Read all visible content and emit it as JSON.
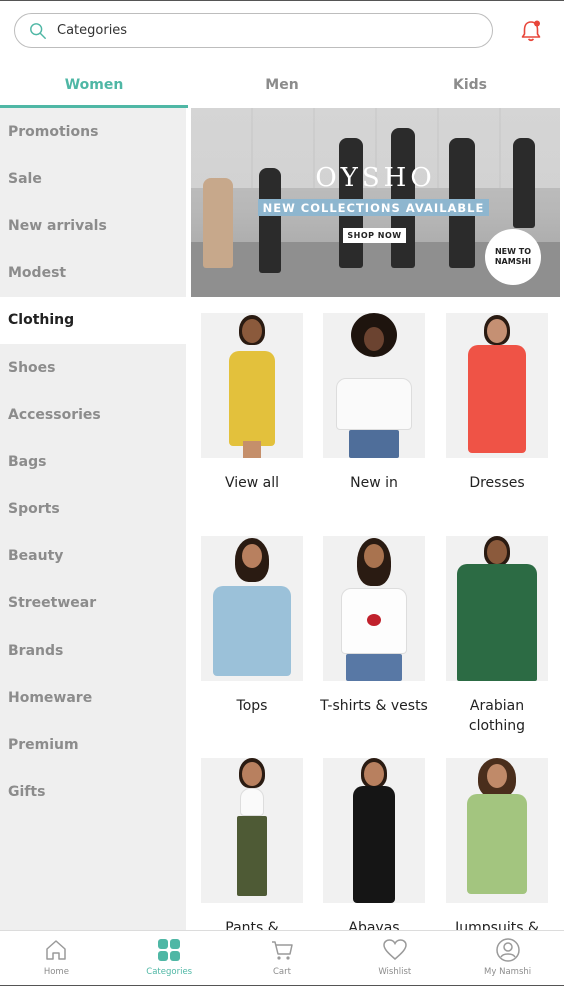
{
  "search": {
    "placeholder": "Categories",
    "icon": "search-icon"
  },
  "notifications": {
    "icon": "bell-icon",
    "accent": "#e8463a"
  },
  "tabs": [
    {
      "label": "Women",
      "active": true
    },
    {
      "label": "Men",
      "active": false
    },
    {
      "label": "Kids",
      "active": false
    }
  ],
  "sidebar": {
    "items": [
      {
        "label": "Promotions"
      },
      {
        "label": "Sale"
      },
      {
        "label": "New arrivals"
      },
      {
        "label": "Modest"
      },
      {
        "label": "Clothing",
        "active": true
      },
      {
        "label": "Shoes"
      },
      {
        "label": "Accessories"
      },
      {
        "label": "Bags"
      },
      {
        "label": "Sports"
      },
      {
        "label": "Beauty"
      },
      {
        "label": "Streetwear"
      },
      {
        "label": "Brands"
      },
      {
        "label": "Homeware"
      },
      {
        "label": "Premium"
      },
      {
        "label": "Gifts"
      }
    ]
  },
  "banner": {
    "brand": "OYSHO",
    "headline": "NEW COLLECTIONS AVAILABLE",
    "cta": "SHOP NOW",
    "badge": "NEW TO NAMSHI"
  },
  "products": [
    {
      "label": "View all"
    },
    {
      "label": "New in"
    },
    {
      "label": "Dresses"
    },
    {
      "label": "Tops"
    },
    {
      "label": "T-shirts & vests"
    },
    {
      "label": "Arabian clothing"
    },
    {
      "label": "Pants &"
    },
    {
      "label": "Abayas"
    },
    {
      "label": "Jumpsuits &"
    }
  ],
  "bottom_nav": [
    {
      "label": "Home",
      "icon": "home-icon"
    },
    {
      "label": "Categories",
      "icon": "categories-icon",
      "active": true
    },
    {
      "label": "Cart",
      "icon": "cart-icon"
    },
    {
      "label": "Wishlist",
      "icon": "heart-icon"
    },
    {
      "label": "My Namshi",
      "icon": "profile-icon"
    }
  ],
  "colors": {
    "accent": "#4fb7a5",
    "sidebar_bg": "#efefef",
    "muted_text": "#8c8c8c"
  }
}
